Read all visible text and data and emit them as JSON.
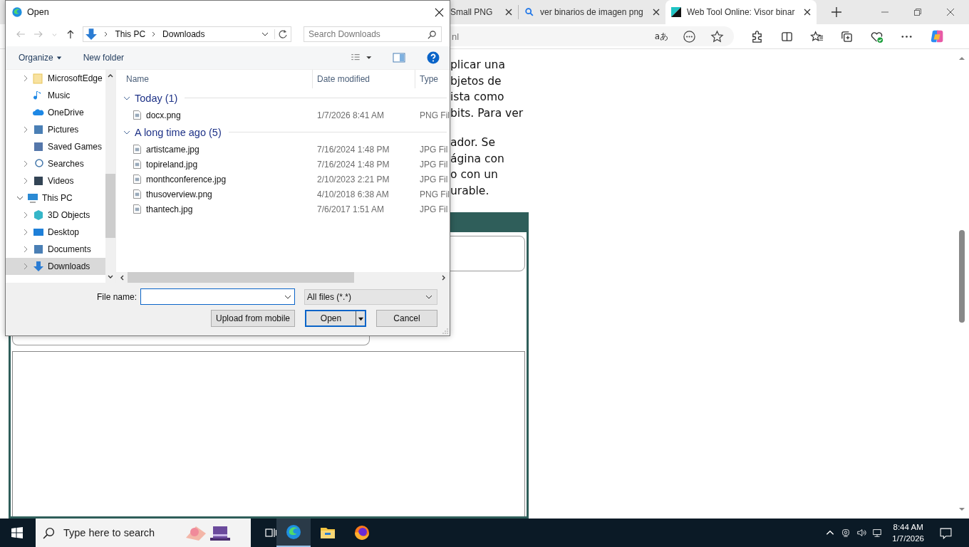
{
  "browser": {
    "tabs": [
      {
        "title": "Small PNG",
        "selected": false,
        "kind": "plain"
      },
      {
        "title": "ver binarios de imagen png",
        "selected": false,
        "kind": "search"
      },
      {
        "title": "Web Tool Online: Visor binar",
        "selected": true,
        "kind": "site"
      }
    ],
    "address": "nl",
    "translate_glyph": "aあ"
  },
  "article": {
    "paragraphs": [
      [
        "plicar una",
        "bjetos de",
        "ista como",
        "bits. Para ver"
      ],
      [
        "ador. Se",
        "ágina con",
        "o con un",
        "urable."
      ]
    ]
  },
  "dialog": {
    "title": "Open",
    "path": [
      "This PC",
      "Downloads"
    ],
    "search_placeholder": "Search Downloads",
    "toolbar": [
      "Organize",
      "New folder"
    ],
    "nav_tree": [
      {
        "label": "MicrosoftEdge",
        "kind": "folder",
        "expandable": true,
        "expanded": false,
        "selected": false
      },
      {
        "label": "Music",
        "kind": "music",
        "expandable": false,
        "selected": false
      },
      {
        "label": "OneDrive",
        "kind": "cloud",
        "expandable": false,
        "selected": false
      },
      {
        "label": "Pictures",
        "kind": "pictures",
        "expandable": true,
        "expanded": false,
        "selected": false
      },
      {
        "label": "Saved Games",
        "kind": "games",
        "expandable": false,
        "selected": false
      },
      {
        "label": "Searches",
        "kind": "search",
        "expandable": true,
        "expanded": false,
        "selected": false
      },
      {
        "label": "Videos",
        "kind": "video",
        "expandable": true,
        "expanded": false,
        "selected": false
      },
      {
        "label": "This PC",
        "kind": "pc",
        "expandable": true,
        "expanded": true,
        "selected": false,
        "children": [
          {
            "label": "3D Objects",
            "kind": "cube",
            "expandable": true,
            "expanded": false,
            "selected": false
          },
          {
            "label": "Desktop",
            "kind": "desktop",
            "expandable": true,
            "expanded": false,
            "selected": false
          },
          {
            "label": "Documents",
            "kind": "document",
            "expandable": true,
            "expanded": false,
            "selected": false
          },
          {
            "label": "Downloads",
            "kind": "download",
            "expandable": true,
            "expanded": false,
            "selected": true
          }
        ]
      }
    ],
    "columns": [
      "Name",
      "Date modified",
      "Type"
    ],
    "groups": [
      {
        "label": "Today (1)",
        "expanded": true,
        "files": [
          {
            "name": "docx.png",
            "date": "1/7/2026 8:41 AM",
            "type": "PNG Fil"
          }
        ]
      },
      {
        "label": "A long time ago (5)",
        "expanded": true,
        "files": [
          {
            "name": "artistcame.jpg",
            "date": "7/16/2024 1:48 PM",
            "type": "JPG Fil"
          },
          {
            "name": "topireland.jpg",
            "date": "7/16/2024 1:48 PM",
            "type": "JPG Fil"
          },
          {
            "name": "monthconference.jpg",
            "date": "2/10/2023 2:21 PM",
            "type": "JPG Fil"
          },
          {
            "name": "thusoverview.png",
            "date": "4/10/2018 6:38 AM",
            "type": "PNG Fil"
          },
          {
            "name": "thantech.jpg",
            "date": "7/6/2017 1:51 AM",
            "type": "JPG Fil"
          }
        ]
      }
    ],
    "file_name_label": "File name:",
    "filter": "All files (*.*)",
    "buttons": [
      {
        "label": "Upload from mobile",
        "kind": "plain",
        "default": false
      },
      {
        "label": "Open",
        "kind": "split",
        "default": true
      },
      {
        "label": "Cancel",
        "kind": "plain",
        "default": false
      }
    ]
  },
  "taskbar": {
    "search_placeholder": "Type here to search",
    "apps": [
      {
        "kind": "edge",
        "active": true
      },
      {
        "kind": "explorer",
        "active": false
      },
      {
        "kind": "firefox",
        "active": false
      }
    ],
    "time": "8:44 AM",
    "date": "1/7/2026"
  }
}
